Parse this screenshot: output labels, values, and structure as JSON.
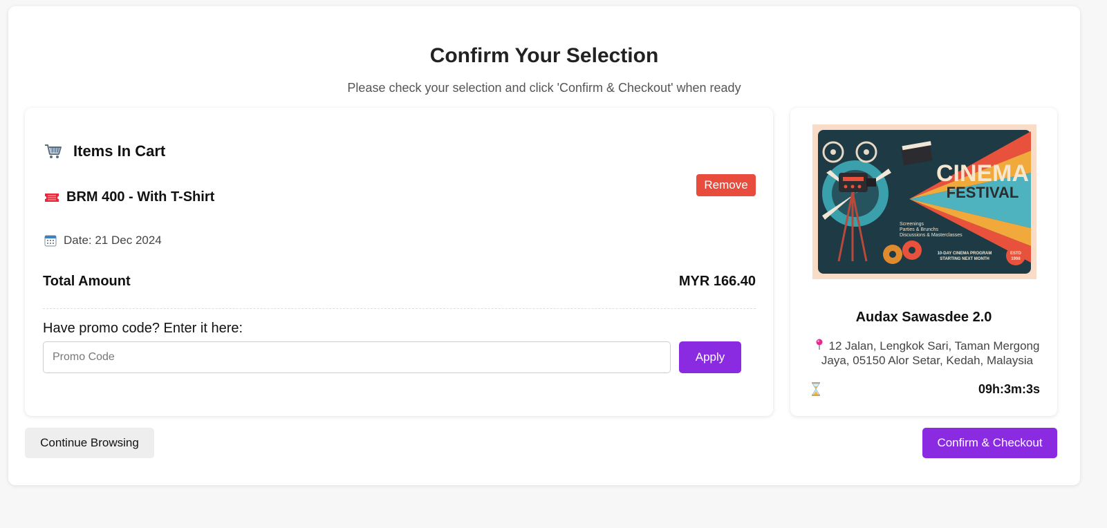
{
  "header": {
    "title": "Confirm Your Selection",
    "subtitle": "Please check your selection and click 'Confirm & Checkout' when ready"
  },
  "cart": {
    "title": "Items In Cart",
    "icon": "shopping-cart-icon",
    "item": {
      "name": "BRM 400 - With T-Shirt",
      "icon": "ticket-icon",
      "remove_label": "Remove",
      "date": "Date: 21 Dec 2024",
      "date_icon": "calendar-icon"
    },
    "total_label": "Total Amount",
    "total_value": "MYR 166.40",
    "promo": {
      "label": "Have promo code? Enter it here:",
      "placeholder": "Promo Code",
      "value": "",
      "apply_label": "Apply"
    }
  },
  "event": {
    "poster": {
      "title_line1": "CINEMA",
      "title_line2": "FESTIVAL",
      "bullets": [
        "Screenings",
        "Parties & Brunchs",
        "Discussions & Masterclasses"
      ],
      "program_line1": "10-DAY CINEMA PROGRAM",
      "program_line2": "STARTING NEXT MONTH",
      "badge_line1": "ESTD",
      "badge_line2": "1998"
    },
    "name": "Audax Sawasdee 2.0",
    "address": "12 Jalan, Lengkok Sari, Taman Mergong Jaya, 05150 Alor Setar, Kedah, Malaysia",
    "address_icon": "pin-icon",
    "timer_icon": "hourglass-icon",
    "countdown": "09h:3m:3s"
  },
  "actions": {
    "continue_label": "Continue Browsing",
    "checkout_label": "Confirm & Checkout"
  },
  "colors": {
    "accent": "#8a2be2",
    "danger": "#e74c3c",
    "secondary": "#eeeeee"
  }
}
